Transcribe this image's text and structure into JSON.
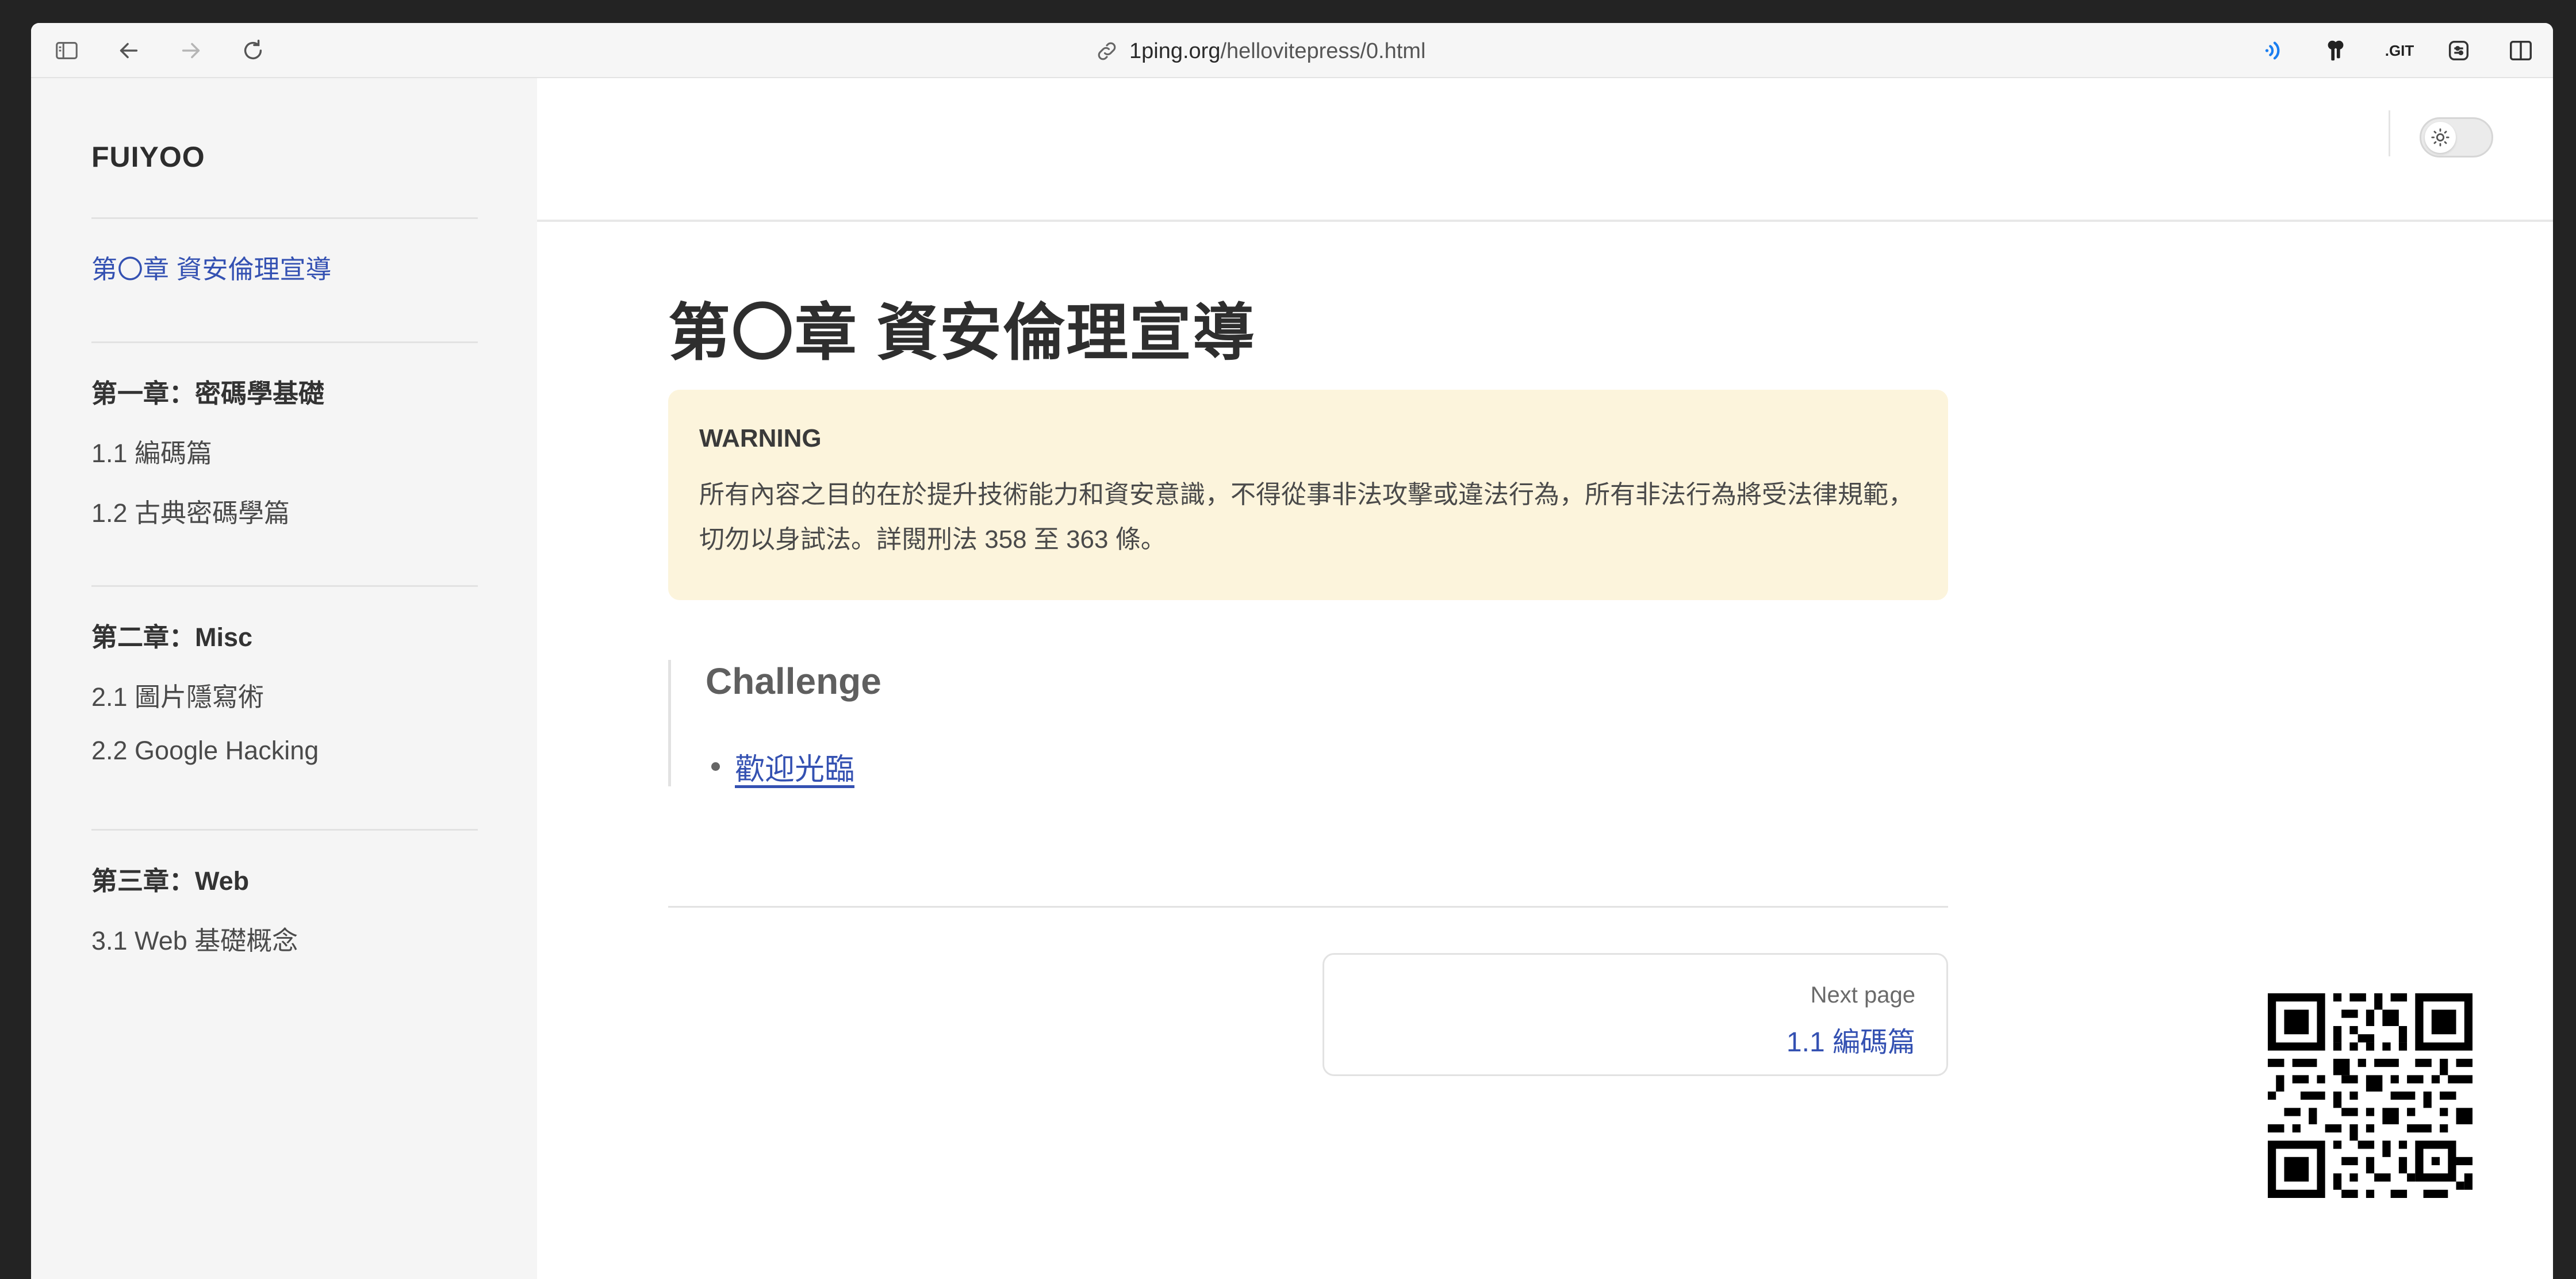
{
  "browser": {
    "address_host": "1ping.org",
    "address_path": "/hellovitepress/0.html",
    "ext_git_label": ".GIT"
  },
  "sidebar": {
    "brand": "FUIYOO",
    "items": [
      {
        "label": "第〇章 資安倫理宣導",
        "active": true
      },
      {
        "group": "第一章：密碼學基礎"
      },
      {
        "label": "1.1 編碼篇"
      },
      {
        "label": "1.2 古典密碼學篇"
      },
      {
        "group": "第二章：Misc"
      },
      {
        "label": "2.1 圖片隱寫術"
      },
      {
        "label": "2.2 Google Hacking"
      },
      {
        "group": "第三章：Web"
      },
      {
        "label": "3.1 Web 基礎概念"
      }
    ]
  },
  "main": {
    "title": "第〇章 資安倫理宣導",
    "warning": {
      "title": "WARNING",
      "text": "所有內容之目的在於提升技術能力和資安意識，不得從事非法攻擊或違法行為，所有非法行為將受法律規範，切勿以身試法。詳閱刑法 358 至 363 條。"
    },
    "challenge": {
      "heading": "Challenge",
      "links": [
        "歡迎光臨"
      ]
    },
    "pager": {
      "next_label": "Next page",
      "next_title": "1.1 編碼篇"
    }
  },
  "colors": {
    "link": "#3451b2",
    "warning_bg": "#fcf4dc",
    "sidebar_bg": "#f5f5f5"
  }
}
